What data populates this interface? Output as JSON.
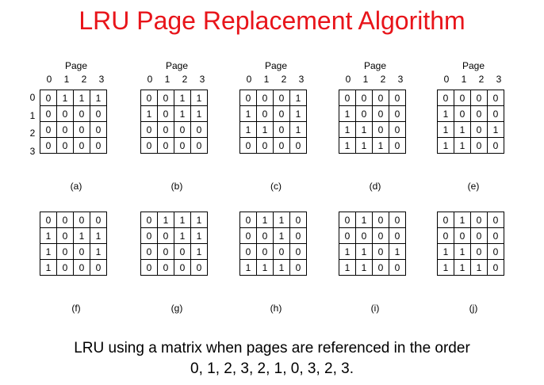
{
  "title": "LRU Page Replacement Algorithm",
  "page_label": "Page",
  "col_labels": [
    "0",
    "1",
    "2",
    "3"
  ],
  "row_labels": [
    "0",
    "1",
    "2",
    "3"
  ],
  "panels": [
    {
      "label": "(a)",
      "matrix": [
        [
          "0",
          "1",
          "1",
          "1"
        ],
        [
          "0",
          "0",
          "0",
          "0"
        ],
        [
          "0",
          "0",
          "0",
          "0"
        ],
        [
          "0",
          "0",
          "0",
          "0"
        ]
      ]
    },
    {
      "label": "(b)",
      "matrix": [
        [
          "0",
          "0",
          "1",
          "1"
        ],
        [
          "1",
          "0",
          "1",
          "1"
        ],
        [
          "0",
          "0",
          "0",
          "0"
        ],
        [
          "0",
          "0",
          "0",
          "0"
        ]
      ]
    },
    {
      "label": "(c)",
      "matrix": [
        [
          "0",
          "0",
          "0",
          "1"
        ],
        [
          "1",
          "0",
          "0",
          "1"
        ],
        [
          "1",
          "1",
          "0",
          "1"
        ],
        [
          "0",
          "0",
          "0",
          "0"
        ]
      ]
    },
    {
      "label": "(d)",
      "matrix": [
        [
          "0",
          "0",
          "0",
          "0"
        ],
        [
          "1",
          "0",
          "0",
          "0"
        ],
        [
          "1",
          "1",
          "0",
          "0"
        ],
        [
          "1",
          "1",
          "1",
          "0"
        ]
      ]
    },
    {
      "label": "(e)",
      "matrix": [
        [
          "0",
          "0",
          "0",
          "0"
        ],
        [
          "1",
          "0",
          "0",
          "0"
        ],
        [
          "1",
          "1",
          "0",
          "1"
        ],
        [
          "1",
          "1",
          "0",
          "0"
        ]
      ]
    },
    {
      "label": "(f)",
      "matrix": [
        [
          "0",
          "0",
          "0",
          "0"
        ],
        [
          "1",
          "0",
          "1",
          "1"
        ],
        [
          "1",
          "0",
          "0",
          "1"
        ],
        [
          "1",
          "0",
          "0",
          "0"
        ]
      ]
    },
    {
      "label": "(g)",
      "matrix": [
        [
          "0",
          "1",
          "1",
          "1"
        ],
        [
          "0",
          "0",
          "1",
          "1"
        ],
        [
          "0",
          "0",
          "0",
          "1"
        ],
        [
          "0",
          "0",
          "0",
          "0"
        ]
      ]
    },
    {
      "label": "(h)",
      "matrix": [
        [
          "0",
          "1",
          "1",
          "0"
        ],
        [
          "0",
          "0",
          "1",
          "0"
        ],
        [
          "0",
          "0",
          "0",
          "0"
        ],
        [
          "1",
          "1",
          "1",
          "0"
        ]
      ]
    },
    {
      "label": "(i)",
      "matrix": [
        [
          "0",
          "1",
          "0",
          "0"
        ],
        [
          "0",
          "0",
          "0",
          "0"
        ],
        [
          "1",
          "1",
          "0",
          "1"
        ],
        [
          "1",
          "1",
          "0",
          "0"
        ]
      ]
    },
    {
      "label": "(j)",
      "matrix": [
        [
          "0",
          "1",
          "0",
          "0"
        ],
        [
          "0",
          "0",
          "0",
          "0"
        ],
        [
          "1",
          "1",
          "0",
          "0"
        ],
        [
          "1",
          "1",
          "1",
          "0"
        ]
      ]
    }
  ],
  "caption_line1": "LRU using a matrix when pages are referenced in the order",
  "caption_line2": "0, 1, 2, 3, 2, 1, 0, 3, 2, 3."
}
